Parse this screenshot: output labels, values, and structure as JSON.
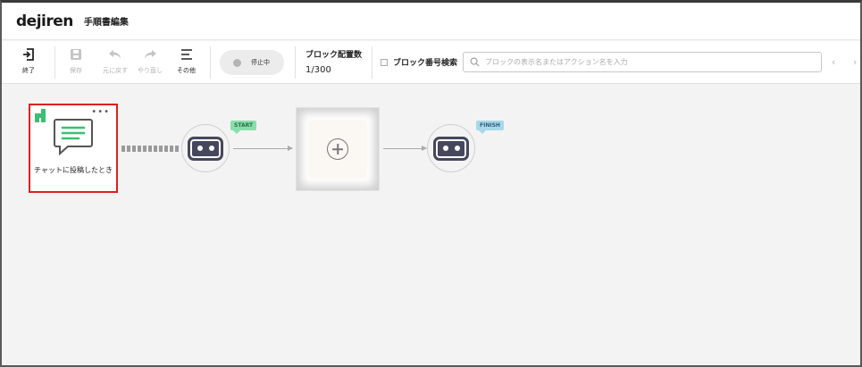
{
  "header": {
    "logo": "dejiren",
    "title": "手順書編集"
  },
  "toolbar": {
    "exit_label": "終了",
    "save_label": "保存",
    "undo_label": "元に戻す",
    "redo_label": "やり直し",
    "more_label": "その他",
    "status_label": "停止中",
    "block_count_label": "ブロック配置数",
    "block_count_value": "1/300",
    "block_number_search_label": "ブロック番号検索",
    "search_placeholder": "ブロックの表示名またはアクション名を入力"
  },
  "canvas": {
    "trigger": {
      "label": "チャットに投稿したとき",
      "more": "•••"
    },
    "start_tag": "START",
    "finish_tag": "FINISH"
  },
  "colors": {
    "selected_border": "#e01f1f",
    "brand_green": "#3bbf73",
    "robot": "#45475d",
    "start_tag": "#86dfa9",
    "finish_tag": "#a8d8ea"
  },
  "icons": [
    "exit-icon",
    "save-icon",
    "undo-icon",
    "redo-icon",
    "menu-icon",
    "search-icon",
    "chevron-left-icon",
    "chevron-right-icon",
    "brand-icon",
    "chat-icon",
    "robot-icon",
    "plus-icon"
  ]
}
